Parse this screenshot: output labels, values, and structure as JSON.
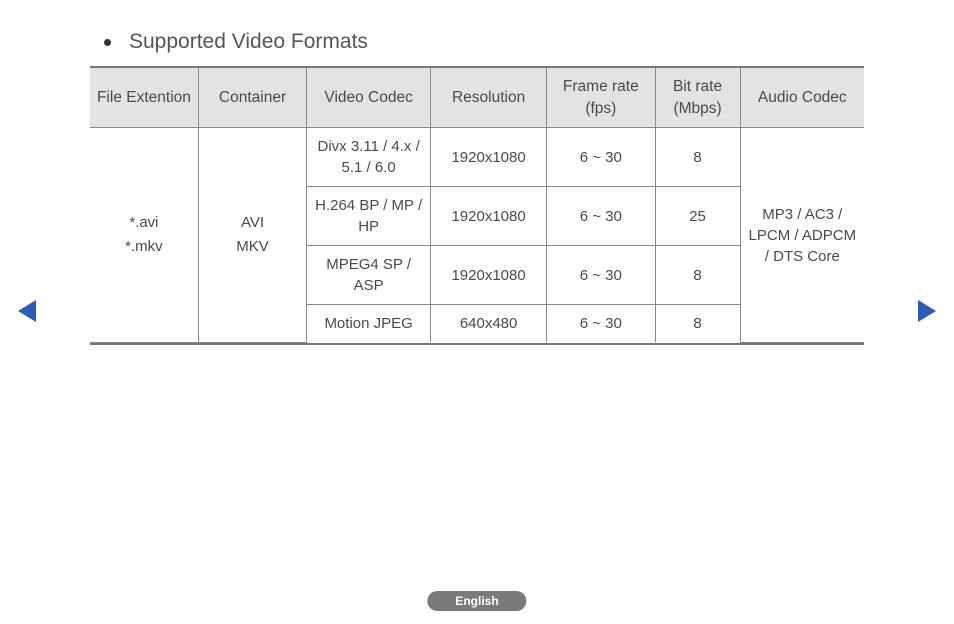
{
  "title": "Supported Video Formats",
  "headers": {
    "ext": "File Extention",
    "container": "Container",
    "vcodec": "Video Codec",
    "resolution": "Resolution",
    "fps": "Frame rate (fps)",
    "bitrate": "Bit rate (Mbps)",
    "acodec": "Audio Codec"
  },
  "group": {
    "extensions": "*.avi\n*.mkv",
    "containers": "AVI\nMKV",
    "audio_codec": "MP3 / AC3 / LPCM / ADPCM / DTS Core"
  },
  "rows": [
    {
      "vcodec": "Divx 3.11 / 4.x / 5.1 / 6.0",
      "resolution": "1920x1080",
      "fps": "6 ~ 30",
      "bitrate": "8"
    },
    {
      "vcodec": "H.264 BP / MP / HP",
      "resolution": "1920x1080",
      "fps": "6 ~ 30",
      "bitrate": "25"
    },
    {
      "vcodec": "MPEG4 SP / ASP",
      "resolution": "1920x1080",
      "fps": "6 ~ 30",
      "bitrate": "8"
    },
    {
      "vcodec": "Motion JPEG",
      "resolution": "640x480",
      "fps": "6 ~ 30",
      "bitrate": "8"
    }
  ],
  "footer": {
    "language": "English"
  }
}
